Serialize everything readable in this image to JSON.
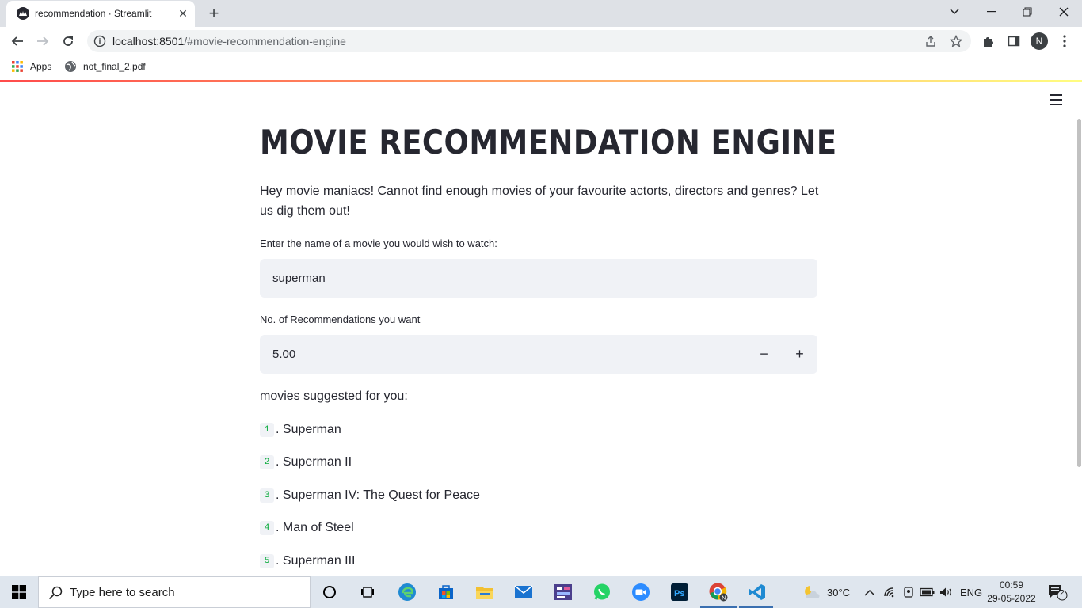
{
  "browser": {
    "tab_title": "recommendation · Streamlit",
    "url_host": "localhost:8501",
    "url_path": "/#movie-recommendation-engine",
    "profile_initial": "N",
    "bookmarks": [
      "Apps",
      "not_final_2.pdf"
    ]
  },
  "app": {
    "title": "MOVIE RECOMMENDATION ENGINE",
    "intro": "Hey movie maniacs! Cannot find enough movies of your favourite actorts, directors and genres? Let us dig them out!",
    "movie_input": {
      "label": "Enter the name of a movie you would wish to watch:",
      "value": "superman"
    },
    "count_input": {
      "label": "No. of Recommendations you want",
      "value": "5.00",
      "minus": "−",
      "plus": "+"
    },
    "results_heading": "movies suggested for you:",
    "recommendations": [
      {
        "num": "1",
        "title": ". Superman"
      },
      {
        "num": "2",
        "title": ". Superman II"
      },
      {
        "num": "3",
        "title": ". Superman IV: The Quest for Peace"
      },
      {
        "num": "4",
        "title": ". Man of Steel"
      },
      {
        "num": "5",
        "title": ". Superman III"
      }
    ]
  },
  "taskbar": {
    "search_placeholder": "Type here to search",
    "weather": "30°C",
    "language": "ENG",
    "time": "00:59",
    "date": "29-05-2022",
    "notifications": "2",
    "icons": [
      "cortana-icon",
      "task-view-icon",
      "edge-icon",
      "store-icon",
      "file-explorer-icon",
      "mail-icon",
      "calculator-app-icon",
      "whatsapp-icon",
      "zoom-icon",
      "photoshop-icon",
      "chrome-icon",
      "vscode-icon"
    ]
  },
  "colors": {
    "accent_red": "#ff4b4b",
    "input_bg": "#f0f2f6",
    "text": "#262730",
    "code_green": "#09ab3b"
  }
}
